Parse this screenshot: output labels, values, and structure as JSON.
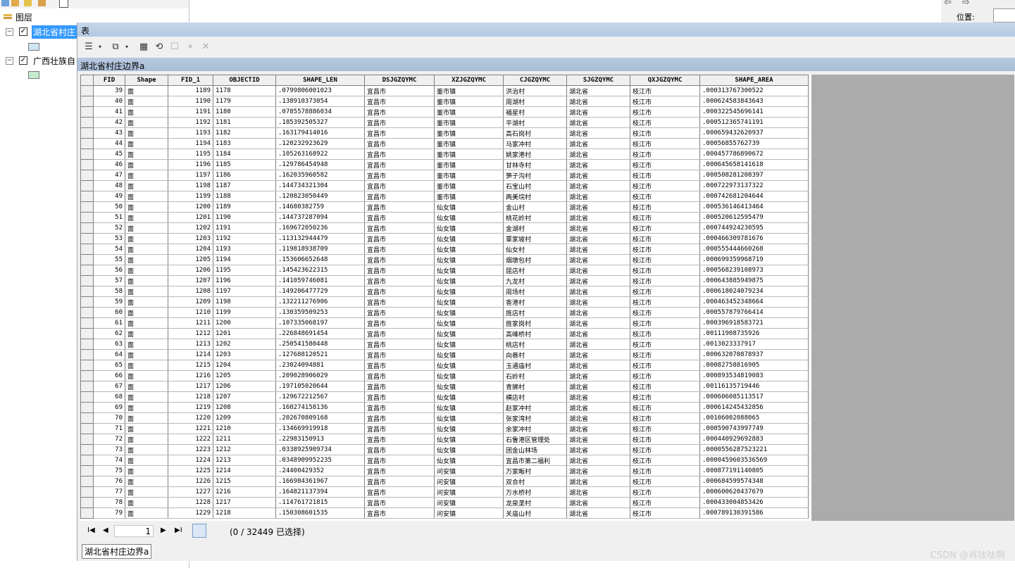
{
  "toc": {
    "header_label": "图层",
    "layers": [
      {
        "name": "湖北省村庄边界a",
        "visible_name": "湖北省村庄",
        "checked": "✓",
        "expander": "−",
        "swatch": "#cfe6f5"
      },
      {
        "name": "广西壮族自治区",
        "visible_name": "广西壮族自",
        "checked": "✓",
        "expander": "−",
        "swatch": "#c6ecd0"
      }
    ]
  },
  "right_panel": {
    "location_label": "位置:"
  },
  "table_window": {
    "title": "表",
    "table_name": "湖北省村庄边界a",
    "columns": [
      "",
      "FID",
      "Shape",
      "FID_1",
      "OBJECTID",
      "SHAPE_LEN",
      "DSJGZQYMC",
      "XZJGZQYMC",
      "CJGZQYMC",
      "SJGZQYMC",
      "QXJGZQYMC",
      "SHAPE_AREA"
    ],
    "rows": [
      [
        "39",
        "面",
        "1189",
        "1178",
        ".0799806001023",
        "宜昌市",
        "董市镇",
        "洪治村",
        "湖北省",
        "枝江市",
        ".000313767300522"
      ],
      [
        "40",
        "面",
        "1190",
        "1179",
        ".138910373054",
        "宜昌市",
        "董市镇",
        "周湖村",
        "湖北省",
        "枝江市",
        ".000624583843643"
      ],
      [
        "41",
        "面",
        "1191",
        "1180",
        ".0785578886034",
        "宜昌市",
        "董市镇",
        "福星村",
        "湖北省",
        "枝江市",
        ".000322545696141"
      ],
      [
        "42",
        "面",
        "1192",
        "1181",
        ".185392505327",
        "宜昌市",
        "董市镇",
        "平湖村",
        "湖北省",
        "枝江市",
        ".000512365741191"
      ],
      [
        "43",
        "面",
        "1193",
        "1182",
        ".163179414016",
        "宜昌市",
        "董市镇",
        "高石岗村",
        "湖北省",
        "枝江市",
        ".000659432620937"
      ],
      [
        "44",
        "面",
        "1194",
        "1183",
        ".120232923629",
        "宜昌市",
        "董市镇",
        "马家冲村",
        "湖北省",
        "枝江市",
        ".00056855762739"
      ],
      [
        "45",
        "面",
        "1195",
        "1184",
        ".105263168922",
        "宜昌市",
        "董市镇",
        "姚家港村",
        "湖北省",
        "枝江市",
        ".000457786890672"
      ],
      [
        "46",
        "面",
        "1196",
        "1185",
        ".129786454948",
        "宜昌市",
        "董市镇",
        "甘林寺村",
        "湖北省",
        "枝江市",
        ".000645658141618"
      ],
      [
        "47",
        "面",
        "1197",
        "1186",
        ".162035960582",
        "宜昌市",
        "董市镇",
        "笋子沟村",
        "湖北省",
        "枝江市",
        ".000508281208397"
      ],
      [
        "48",
        "面",
        "1198",
        "1187",
        ".144734321304",
        "宜昌市",
        "董市镇",
        "石宝山村",
        "湖北省",
        "枝江市",
        ".000722973137322"
      ],
      [
        "49",
        "面",
        "1199",
        "1188",
        ".120823050449",
        "宜昌市",
        "董市镇",
        "两美垸村",
        "湖北省",
        "枝江市",
        ".000742681204644"
      ],
      [
        "50",
        "面",
        "1200",
        "1189",
        ".14680382759",
        "宜昌市",
        "仙女镇",
        "金山村",
        "湖北省",
        "枝江市",
        ".000536146413464"
      ],
      [
        "51",
        "面",
        "1201",
        "1190",
        ".144737287094",
        "宜昌市",
        "仙女镇",
        "桃花岭村",
        "湖北省",
        "枝江市",
        ".000520612595479"
      ],
      [
        "52",
        "面",
        "1202",
        "1191",
        ".169672050236",
        "宜昌市",
        "仙女镇",
        "金湖村",
        "湖北省",
        "枝江市",
        ".000744924230595"
      ],
      [
        "53",
        "面",
        "1203",
        "1192",
        ".113132944479",
        "宜昌市",
        "仙女镇",
        "覃家坡村",
        "湖北省",
        "枝江市",
        ".000466309781676"
      ],
      [
        "54",
        "面",
        "1204",
        "1193",
        ".119818938709",
        "宜昌市",
        "仙女镇",
        "仙女村",
        "湖北省",
        "枝江市",
        ".000555444660268"
      ],
      [
        "55",
        "面",
        "1205",
        "1194",
        ".153606652648",
        "宜昌市",
        "仙女镇",
        "烟墩包村",
        "湖北省",
        "枝江市",
        ".000699359968719"
      ],
      [
        "56",
        "面",
        "1206",
        "1195",
        ".145423622315",
        "宜昌市",
        "仙女镇",
        "屈店村",
        "湖北省",
        "枝江市",
        ".000568239108973"
      ],
      [
        "57",
        "面",
        "1207",
        "1196",
        ".141059746081",
        "宜昌市",
        "仙女镇",
        "九龙村",
        "湖北省",
        "枝江市",
        ".000643885949875"
      ],
      [
        "58",
        "面",
        "1208",
        "1197",
        ".149206477729",
        "宜昌市",
        "仙女镇",
        "周场村",
        "湖北省",
        "枝江市",
        ".000618024079234"
      ],
      [
        "59",
        "面",
        "1209",
        "1198",
        ".132211276906",
        "宜昌市",
        "仙女镇",
        "香港村",
        "湖北省",
        "枝江市",
        ".000463452348664"
      ],
      [
        "60",
        "面",
        "1210",
        "1199",
        ".130359509253",
        "宜昌市",
        "仙女镇",
        "旌店村",
        "湖北省",
        "枝江市",
        ".000557879766414"
      ],
      [
        "61",
        "面",
        "1211",
        "1200",
        ".107335068197",
        "宜昌市",
        "仙女镇",
        "旌家岗村",
        "湖北省",
        "枝江市",
        ".000396918583721"
      ],
      [
        "62",
        "面",
        "1212",
        "1201",
        ".226848691454",
        "宜昌市",
        "仙女镇",
        "高峰桥村",
        "湖北省",
        "枝江市",
        ".00111908735926"
      ],
      [
        "63",
        "面",
        "1213",
        "1202",
        ".250541580448",
        "宜昌市",
        "仙女镇",
        "桃店村",
        "湖北省",
        "枝江市",
        ".0013023337917"
      ],
      [
        "64",
        "面",
        "1214",
        "1203",
        ".127688120521",
        "宜昌市",
        "仙女镇",
        "向巷村",
        "湖北省",
        "枝江市",
        ".000632070878937"
      ],
      [
        "65",
        "面",
        "1215",
        "1204",
        ".23024094881",
        "宜昌市",
        "仙女镇",
        "玉通庙村",
        "湖北省",
        "枝江市",
        ".00082758816905"
      ],
      [
        "66",
        "面",
        "1216",
        "1205",
        ".209028906029",
        "宜昌市",
        "仙女镇",
        "石岭村",
        "湖北省",
        "枝江市",
        ".000893534819083"
      ],
      [
        "67",
        "面",
        "1217",
        "1206",
        ".197105020644",
        "宜昌市",
        "仙女镇",
        "青狮村",
        "湖北省",
        "枝江市",
        ".00116135719446"
      ],
      [
        "68",
        "面",
        "1218",
        "1207",
        ".129672212567",
        "宜昌市",
        "仙女镇",
        "横店村",
        "湖北省",
        "枝江市",
        ".000606085113517"
      ],
      [
        "69",
        "面",
        "1219",
        "1208",
        ".160274158136",
        "宜昌市",
        "仙女镇",
        "赵家冲村",
        "湖北省",
        "枝江市",
        ".000614245432856"
      ],
      [
        "70",
        "面",
        "1220",
        "1209",
        ".202670809168",
        "宜昌市",
        "仙女镇",
        "张家湾村",
        "湖北省",
        "枝江市",
        ".00106002088065"
      ],
      [
        "71",
        "面",
        "1221",
        "1210",
        ".134669919918",
        "宜昌市",
        "仙女镇",
        "余家冲村",
        "湖北省",
        "枝江市",
        ".000590743997749"
      ],
      [
        "72",
        "面",
        "1222",
        "1211",
        ".22983150913",
        "宜昌市",
        "仙女镇",
        "石鲁港区管理处",
        "湖北省",
        "枝江市",
        ".000440929692883"
      ],
      [
        "73",
        "面",
        "1223",
        "1212",
        ".0338925909734",
        "宜昌市",
        "仙女镇",
        "团金山林场",
        "湖北省",
        "枝江市",
        ".0000556287523221"
      ],
      [
        "74",
        "面",
        "1224",
        "1213",
        ".0348909952235",
        "宜昌市",
        "仙女镇",
        "宜昌市第二福利",
        "湖北省",
        "枝江市",
        ".0000459603536569"
      ],
      [
        "75",
        "面",
        "1225",
        "1214",
        ".24400429352",
        "宜昌市",
        "问安镇",
        "万家畈村",
        "湖北省",
        "枝江市",
        ".000877191140805"
      ],
      [
        "76",
        "面",
        "1226",
        "1215",
        ".166984361967",
        "宜昌市",
        "问安镇",
        "双合村",
        "湖北省",
        "枝江市",
        ".000684599574348"
      ],
      [
        "77",
        "面",
        "1227",
        "1216",
        ".164821137394",
        "宜昌市",
        "问安镇",
        "万水桥村",
        "湖北省",
        "枝江市",
        ".000600620437679"
      ],
      [
        "78",
        "面",
        "1228",
        "1217",
        ".114761721815",
        "宜昌市",
        "问安镇",
        "龙泉垄村",
        "湖北省",
        "枝江市",
        ".000433004853426"
      ],
      [
        "79",
        "面",
        "1229",
        "1218",
        ".150308601535",
        "宜昌市",
        "问安镇",
        "关庙山村",
        "湖北省",
        "枝江市",
        ".000789130391586"
      ]
    ],
    "footer": {
      "first": "I◀",
      "prev": "◀",
      "record": "1",
      "next": "▶",
      "last": "▶I",
      "selection_text": "(0 / 32449 已选择)"
    },
    "tab_label": "湖北省村庄边界a"
  },
  "watermark": "CSDN @肖呔呔啊"
}
